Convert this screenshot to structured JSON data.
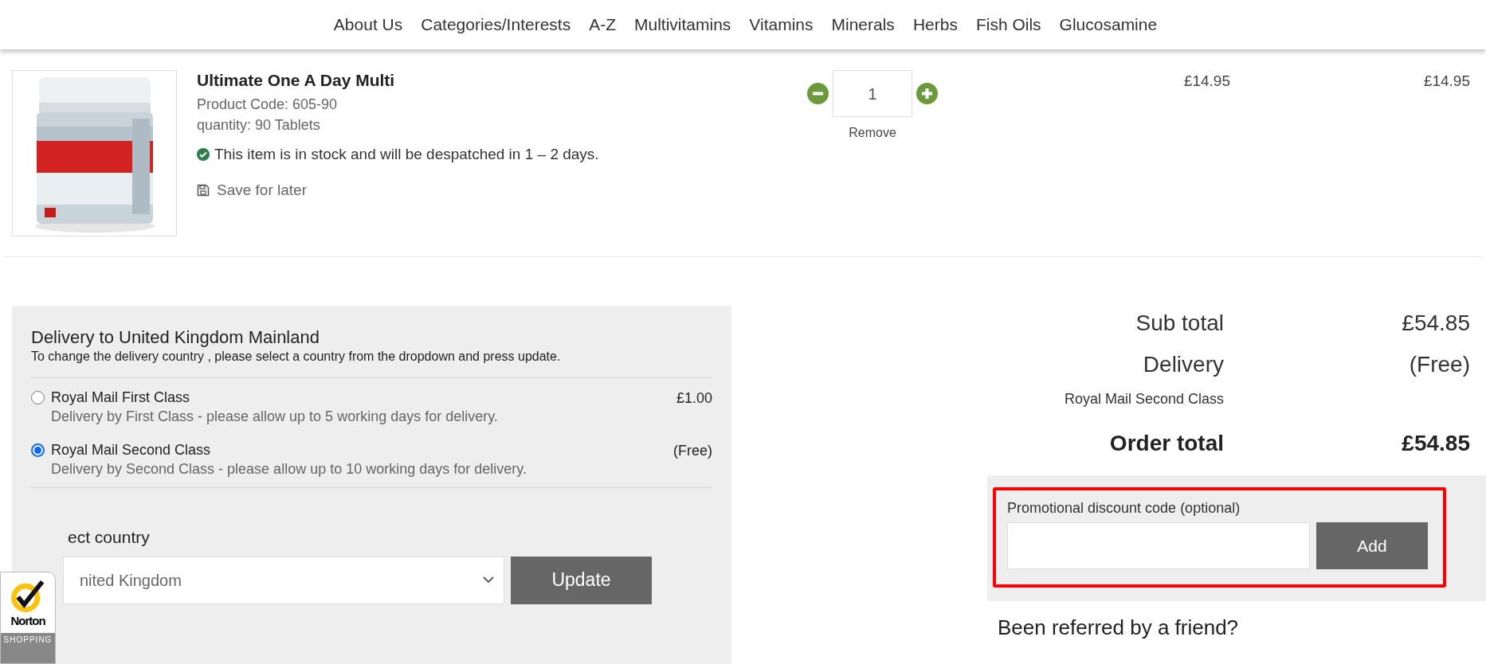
{
  "nav": [
    "About Us",
    "Categories/Interests",
    "A-Z",
    "Multivitamins",
    "Vitamins",
    "Minerals",
    "Herbs",
    "Fish Oils",
    "Glucosamine"
  ],
  "cart_item": {
    "title": "Ultimate One A Day Multi",
    "product_code": "Product Code: 605-90",
    "quantity_text": "quantity: 90 Tablets",
    "stock_message": "This item is in stock and will be despatched in 1 – 2 days.",
    "save_label": "Save for later",
    "quantity": "1",
    "remove": "Remove",
    "unit_price": "£14.95",
    "line_total": "£14.95"
  },
  "delivery": {
    "heading": "Delivery to United Kingdom Mainland",
    "note": "To change the delivery country , please select a country from the dropdown and press update.",
    "options": [
      {
        "label": "Royal Mail First Class",
        "description": "Delivery by First Class - please allow up to 5 working days for delivery.",
        "price": "£1.00",
        "selected": false
      },
      {
        "label": "Royal Mail Second Class",
        "description": "Delivery by Second Class - please allow up to 10 working days for delivery.",
        "price": "(Free)",
        "selected": true
      }
    ],
    "country_label": "ect country",
    "country_value": "nited Kingdom",
    "update_button": "Update"
  },
  "totals": [
    {
      "kind": "plain",
      "label": "Sub total",
      "value": "£54.85"
    },
    {
      "kind": "plain",
      "label": "Delivery",
      "value": "(Free)",
      "detail": "Royal Mail Second Class"
    },
    {
      "kind": "grand",
      "label": "Order total",
      "value": "£54.85"
    }
  ],
  "promo": {
    "label": "Promotional discount code (optional)",
    "button": "Add",
    "highlighted": true
  },
  "referral": "Been referred by a friend?",
  "badge": {
    "logo": "Norton",
    "caption": "SHOPPING"
  }
}
